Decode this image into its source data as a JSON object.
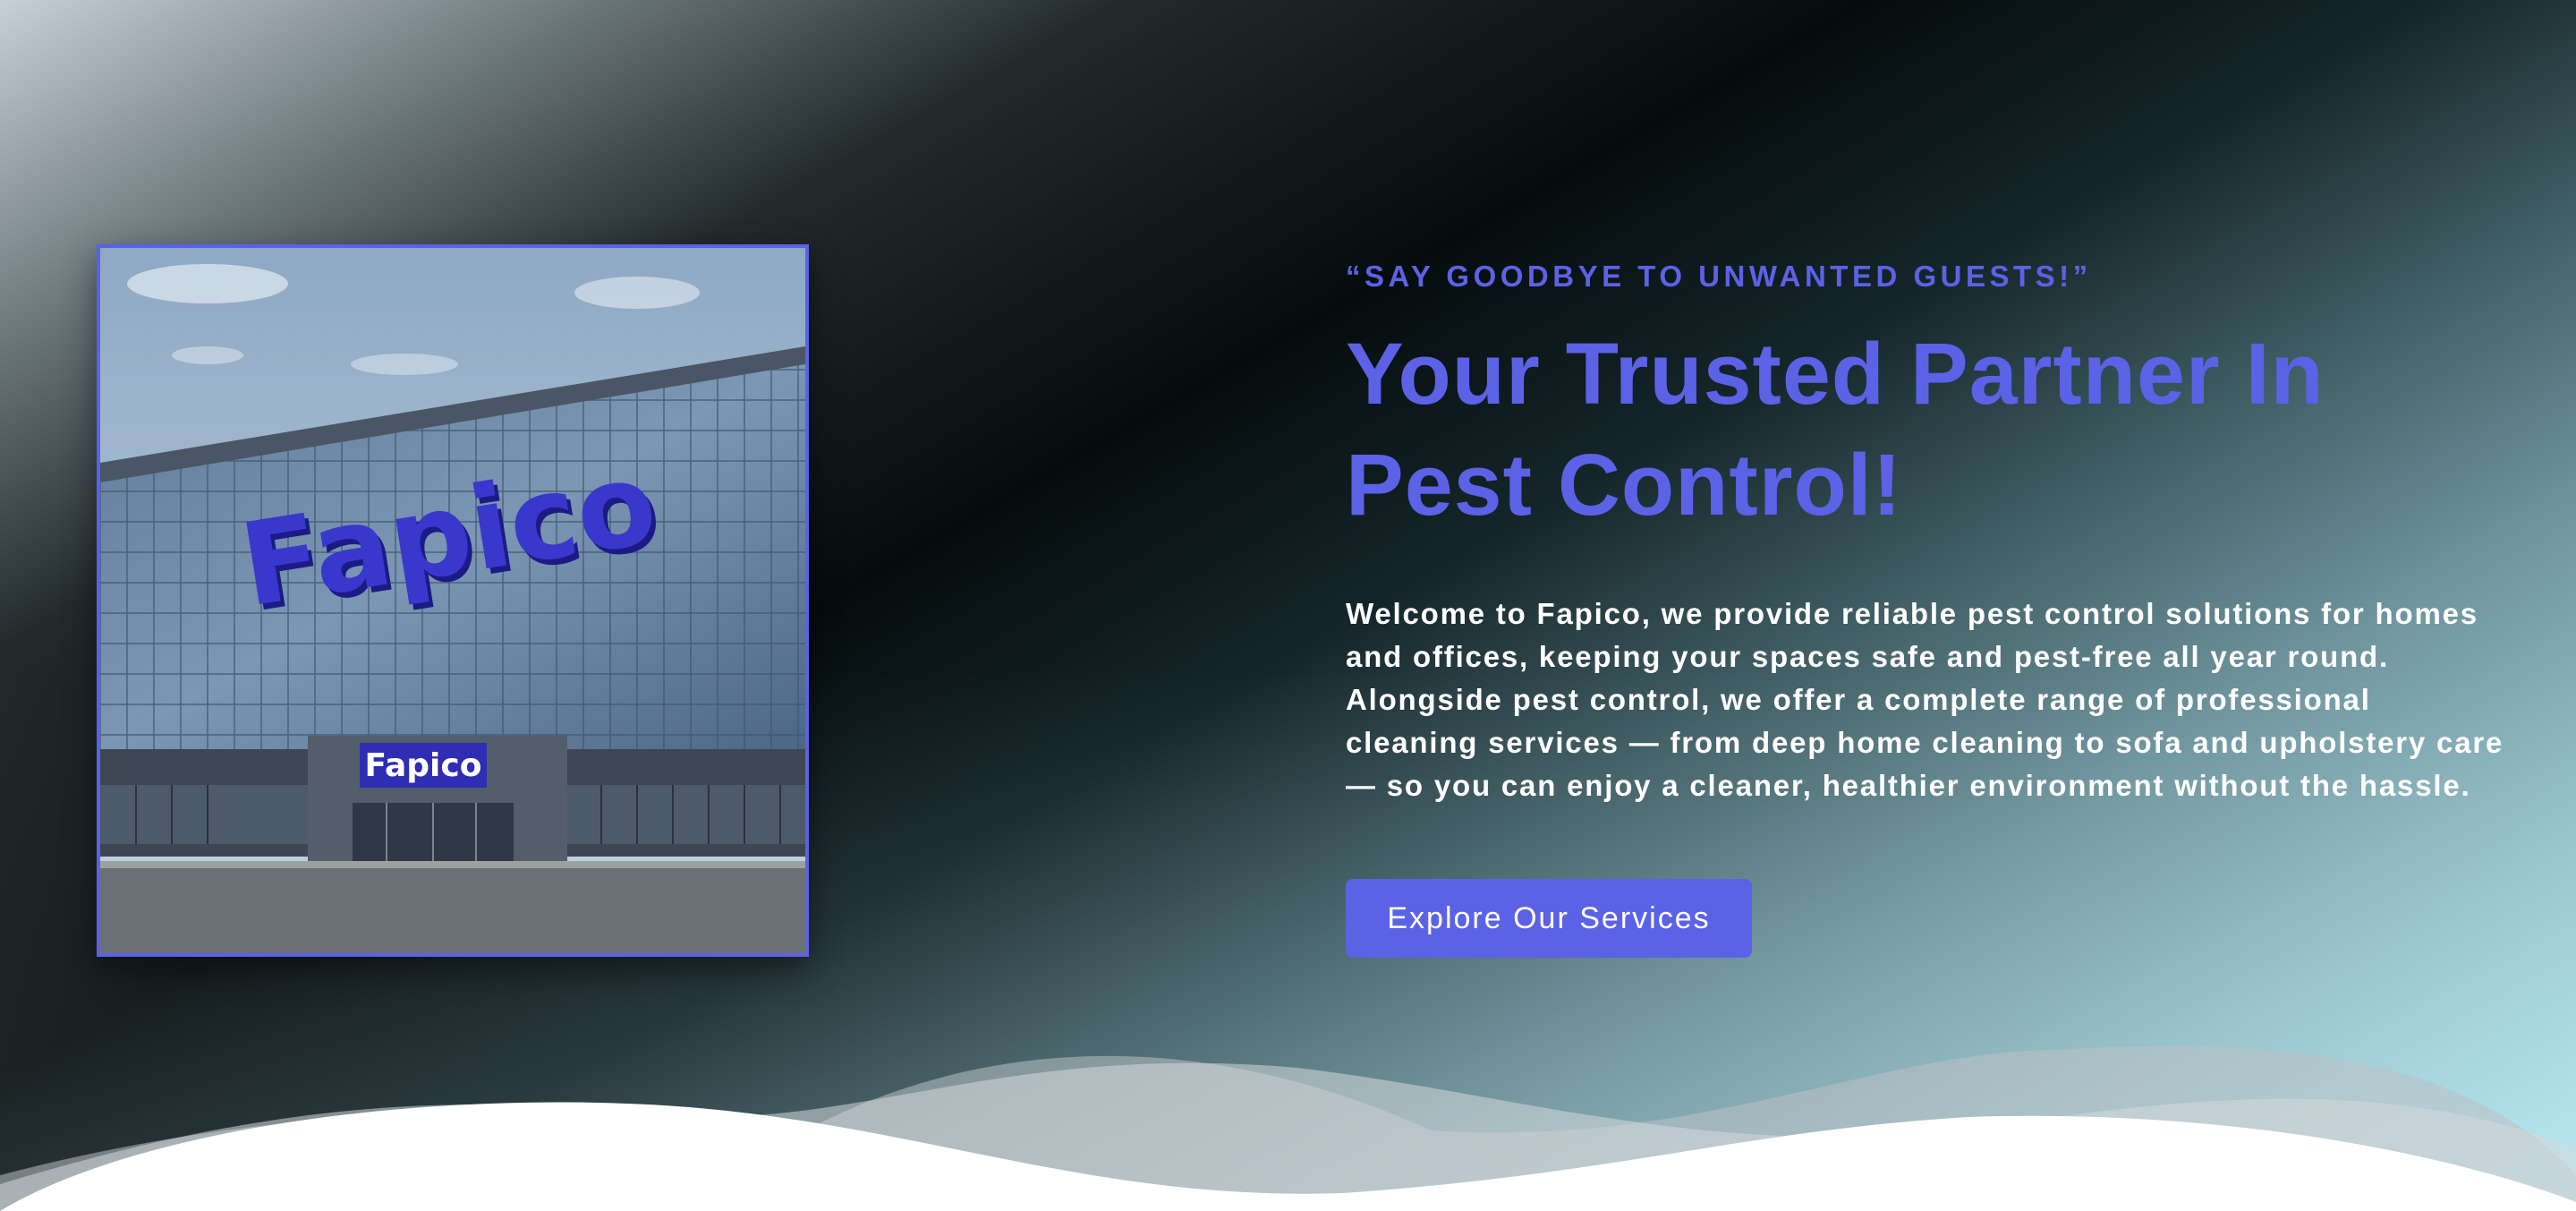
{
  "hero": {
    "image": {
      "alt": "Fapico building",
      "sign_text": "Fapico",
      "entrance_sign_text": "Fapico"
    },
    "eyebrow": "“SAY GOODBYE TO UNWANTED GUESTS!”",
    "headline": "Your Trusted Partner In Pest Control!",
    "description": "Welcome to Fapico, we provide reliable pest control solutions for homes and offices, keeping your spaces safe and pest-free all year round. Alongside pest control, we offer a complete range of professional cleaning services — from deep home cleaning to sofa and upholstery care — so you can enjoy a cleaner, healthier environment without the hassle.",
    "cta_label": "Explore Our Services"
  },
  "colors": {
    "accent": "#5c62e6",
    "text_light": "#ffffff",
    "background_dark": "#050c0d",
    "background_light": "#b6eef8"
  }
}
